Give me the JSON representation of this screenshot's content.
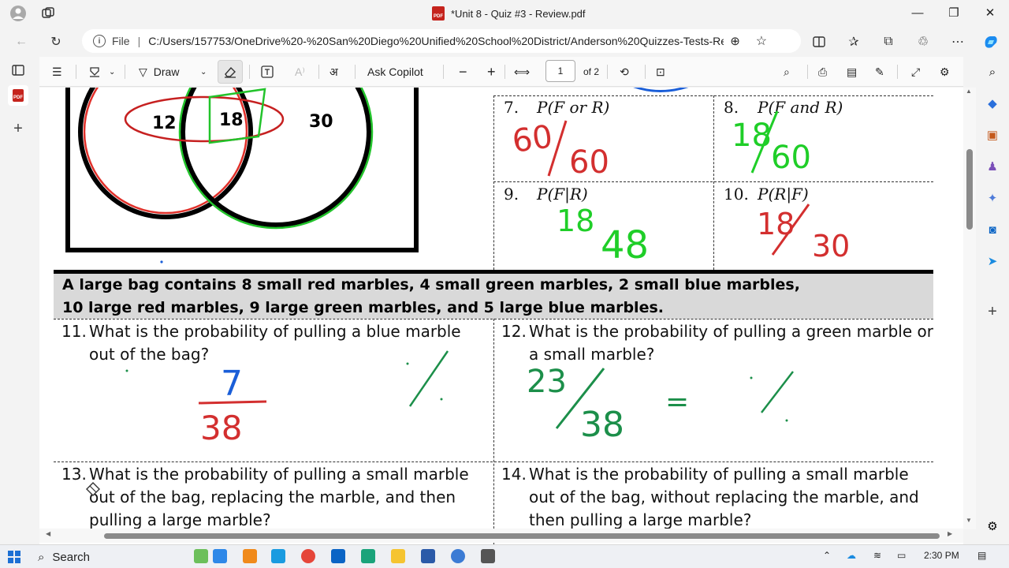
{
  "window": {
    "title": "*Unit 8 - Quiz #3 - Review.pdf",
    "pdf_badge": "PDF"
  },
  "address": {
    "info_icon": "info-icon",
    "file_label": "File",
    "separator": "|",
    "url": "C:/Users/157753/OneDrive%20-%20San%20Diego%20Unified%20School%20District/Anderson%20Quizzes-Tests-Revi..."
  },
  "toolbar": {
    "draw_label": "Draw",
    "ask_copilot_label": "Ask Copilot",
    "page_current": "1",
    "page_total": "of 2"
  },
  "venn": {
    "left_value": "12",
    "center_value": "18",
    "right_value": "30"
  },
  "grid_questions": [
    {
      "num": "7.",
      "expr": "P(F or R)",
      "answer_num": "60",
      "answer_den": "60",
      "color": "#d32f2f"
    },
    {
      "num": "8.",
      "expr": "P(F and R)",
      "answer_num": "18",
      "answer_den": "60",
      "color": "#1fce28"
    },
    {
      "num": "9.",
      "expr": "P(F|R)",
      "answer_num": "18",
      "answer_den": "48",
      "color": "#1fce28"
    },
    {
      "num": "10.",
      "expr": "P(R|F)",
      "answer_num": "18",
      "answer_den": "30",
      "color": "#d32f2f"
    }
  ],
  "banner": {
    "line1": "A large bag contains 8 small red marbles, 4 small green marbles, 2 small blue marbles,",
    "line2": "10 large red marbles, 9 large green marbles, and 5 large blue marbles."
  },
  "questions": [
    {
      "num": "11.",
      "line1": "What is the probability of pulling a blue marble",
      "line2": "out of the bag?",
      "line3": "",
      "answer_num": "7",
      "answer_den": "38"
    },
    {
      "num": "12.",
      "line1": "What is the probability of pulling a green marble or",
      "line2": "a small marble?",
      "line3": "",
      "answer_num": "23",
      "answer_den": "38",
      "answer_extra": "="
    },
    {
      "num": "13.",
      "line1": "What is the probability of pulling a small marble",
      "line2": "out of the bag, replacing the marble, and then",
      "line3": "pulling a large marble?"
    },
    {
      "num": "14.",
      "line1": "What is the probability of pulling a small marble",
      "line2": "out of the bag, without replacing the marble, and",
      "line3": "then pulling a large marble?"
    }
  ],
  "taskbar": {
    "search_label": "Search",
    "time": "2:30 PM"
  },
  "colors": {
    "ink_red": "#d32f2f",
    "ink_green": "#1fce28",
    "ink_teal": "#1c8f4a",
    "ink_blue": "#1a5ed8",
    "banner_bg": "#d9d9d9"
  }
}
